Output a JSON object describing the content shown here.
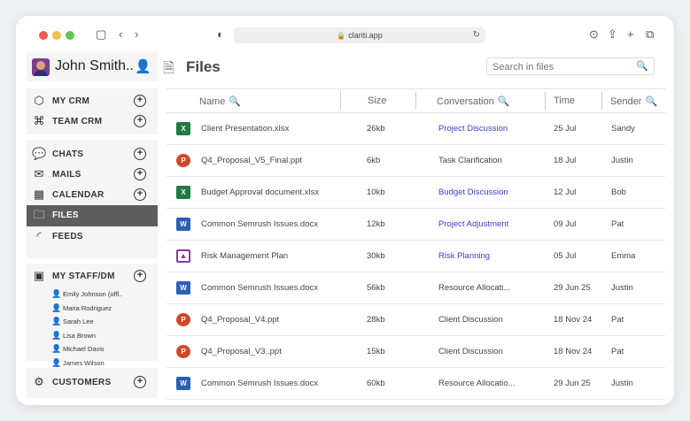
{
  "browser": {
    "url": "clariti.app"
  },
  "user": {
    "name": "John Smith.."
  },
  "sidebar": {
    "group1": [
      {
        "label": "MY CRM",
        "icon": "hexagon-icon"
      },
      {
        "label": "TEAM CRM",
        "icon": "network-icon"
      }
    ],
    "group2": [
      {
        "label": "CHATS",
        "icon": "chat-icon"
      },
      {
        "label": "MAILS",
        "icon": "mail-icon"
      },
      {
        "label": "CALENDAR",
        "icon": "calendar-icon"
      },
      {
        "label": "FILES",
        "icon": "folder-icon",
        "active": true
      },
      {
        "label": "FEEDS",
        "icon": "rss-icon"
      }
    ],
    "staff_header": "MY STAFF/DM",
    "staff": [
      {
        "name": "Emily Johnson (offl..",
        "status": "offline"
      },
      {
        "name": "Maria Rodriguez",
        "status": "online"
      },
      {
        "name": "Sarah Lee",
        "status": "online"
      },
      {
        "name": "Lisa Brown",
        "status": "online"
      },
      {
        "name": "Michael Davis",
        "status": "online"
      },
      {
        "name": "James Wilson",
        "status": "online"
      }
    ],
    "customers_label": "CUSTOMERS"
  },
  "main": {
    "title": "Files",
    "search_placeholder": "Search in files",
    "columns": {
      "name": "Name",
      "size": "Size",
      "conversation": "Conversation",
      "time": "Time",
      "sender": "Sender"
    },
    "rows": [
      {
        "type": "xlsx",
        "badge": "X",
        "name": "Client Presentation.xlsx",
        "size": "26kb",
        "conversation": "Project Discussion",
        "conv_link": true,
        "time": "25 Jul",
        "sender": "Sandy"
      },
      {
        "type": "ppt",
        "badge": "P",
        "name": "Q4_Proposal_V5_Final.ppt",
        "size": "6kb",
        "conversation": "Task Clarification",
        "conv_link": false,
        "time": "18 Jul",
        "sender": "Justin"
      },
      {
        "type": "xlsx",
        "badge": "X",
        "name": "Budget Approval document.xlsx",
        "size": "10kb",
        "conversation": "Budget Discussion",
        "conv_link": true,
        "time": "12 Jul",
        "sender": "Bob"
      },
      {
        "type": "docx",
        "badge": "W",
        "name": "Common Semrush Issues.docx",
        "size": "12kb",
        "conversation": "Project Adjustment",
        "conv_link": true,
        "time": "09 Jul",
        "sender": "Pat"
      },
      {
        "type": "plan",
        "badge": "▲",
        "name": "Risk Management Plan",
        "size": "30kb",
        "conversation": "Risk Planning",
        "conv_link": true,
        "time": "05 Jul",
        "sender": "Emma"
      },
      {
        "type": "docx",
        "badge": "W",
        "name": "Common Semrush Issues.docx",
        "size": "56kb",
        "conversation": "Resource Allocati...",
        "conv_link": false,
        "time": "29 Jun 25",
        "sender": "Justin"
      },
      {
        "type": "ppt",
        "badge": "P",
        "name": "Q4_Proposal_V4.ppt",
        "size": "28kb",
        "conversation": "Client Discussion",
        "conv_link": false,
        "time": "18 Nov 24",
        "sender": "Pat"
      },
      {
        "type": "ppt",
        "badge": "P",
        "name": "Q4_Proposal_V3..ppt",
        "size": "15kb",
        "conversation": "Client Discussion",
        "conv_link": false,
        "time": "18 Nov 24",
        "sender": "Pat"
      },
      {
        "type": "docx",
        "badge": "W",
        "name": "Common Semrush Issues.docx",
        "size": "60kb",
        "conversation": "Resource Allocatio...",
        "conv_link": false,
        "time": "29 Jun 25",
        "sender": "Justin"
      }
    ]
  },
  "colors": {
    "link": "#3b3bd6",
    "active_nav": "#5d5d5d",
    "online": "#38b04a",
    "offline": "#e06a2c"
  }
}
